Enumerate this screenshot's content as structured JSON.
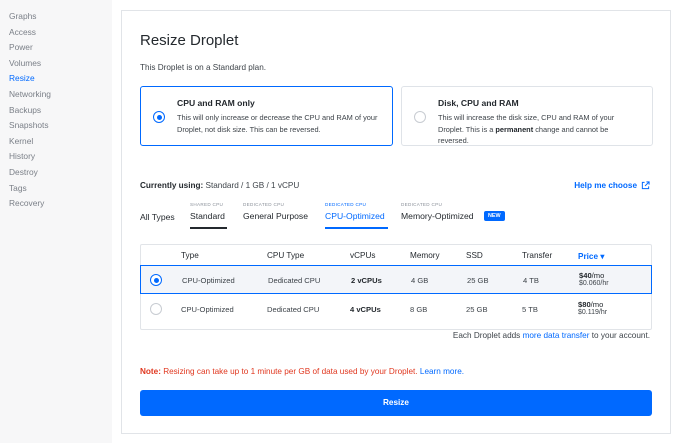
{
  "sidebar": {
    "items": [
      "Graphs",
      "Access",
      "Power",
      "Volumes",
      "Resize",
      "Networking",
      "Backups",
      "Snapshots",
      "Kernel",
      "History",
      "Destroy",
      "Tags",
      "Recovery"
    ],
    "active": "Resize"
  },
  "page": {
    "title": "Resize Droplet",
    "subtitle": "This Droplet is on a Standard plan."
  },
  "options": {
    "cpu_ram": {
      "title": "CPU and RAM only",
      "description": "This will only increase or decrease the CPU and RAM of your Droplet, not disk size. This can be reversed."
    },
    "disk_cpu_ram": {
      "title": "Disk, CPU and RAM",
      "desc_before": "This will increase the disk size, CPU and RAM of your Droplet. This is a ",
      "desc_bold": "permanent",
      "desc_after": " change and cannot be reversed."
    }
  },
  "current": {
    "label": "Currently using:",
    "value": "Standard / 1 GB / 1 vCPU"
  },
  "help_link": "Help me choose",
  "tabs": {
    "all": "All Types",
    "standard": {
      "small": "SHARED CPU",
      "label": "Standard"
    },
    "general": {
      "small": "DEDICATED CPU",
      "label": "General Purpose"
    },
    "cpu": {
      "small": "DEDICATED CPU",
      "label": "CPU-Optimized"
    },
    "memory": {
      "small": "DEDICATED CPU",
      "label": "Memory-Optimized",
      "badge": "NEW"
    }
  },
  "table": {
    "headers": {
      "type": "Type",
      "cpu_type": "CPU Type",
      "vcpus": "vCPUs",
      "memory": "Memory",
      "ssd": "SSD",
      "transfer": "Transfer",
      "price": "Price"
    },
    "rows": [
      {
        "type": "CPU-Optimized",
        "cpu_type": "Dedicated CPU",
        "vcpus": "2 vCPUs",
        "memory": "4 GB",
        "ssd": "25 GB",
        "transfer": "4 TB",
        "price_mo": "$40",
        "mo_suffix": "/mo",
        "price_hr": "$0.060/hr"
      },
      {
        "type": "CPU-Optimized",
        "cpu_type": "Dedicated CPU",
        "vcpus": "4 vCPUs",
        "memory": "8 GB",
        "ssd": "25 GB",
        "transfer": "5 TB",
        "price_mo": "$80",
        "mo_suffix": "/mo",
        "price_hr": "$0.119/hr"
      }
    ]
  },
  "transfer_note": {
    "before": "Each Droplet adds ",
    "link": "more data transfer",
    "after": " to your account."
  },
  "note": {
    "bold": "Note:",
    "text": " Resizing can take up to 1 minute per GB of data used by your Droplet. ",
    "link": "Learn more."
  },
  "resize_button": "Resize",
  "colors": {
    "accent": "#0069ff",
    "warning": "#e0371f"
  }
}
